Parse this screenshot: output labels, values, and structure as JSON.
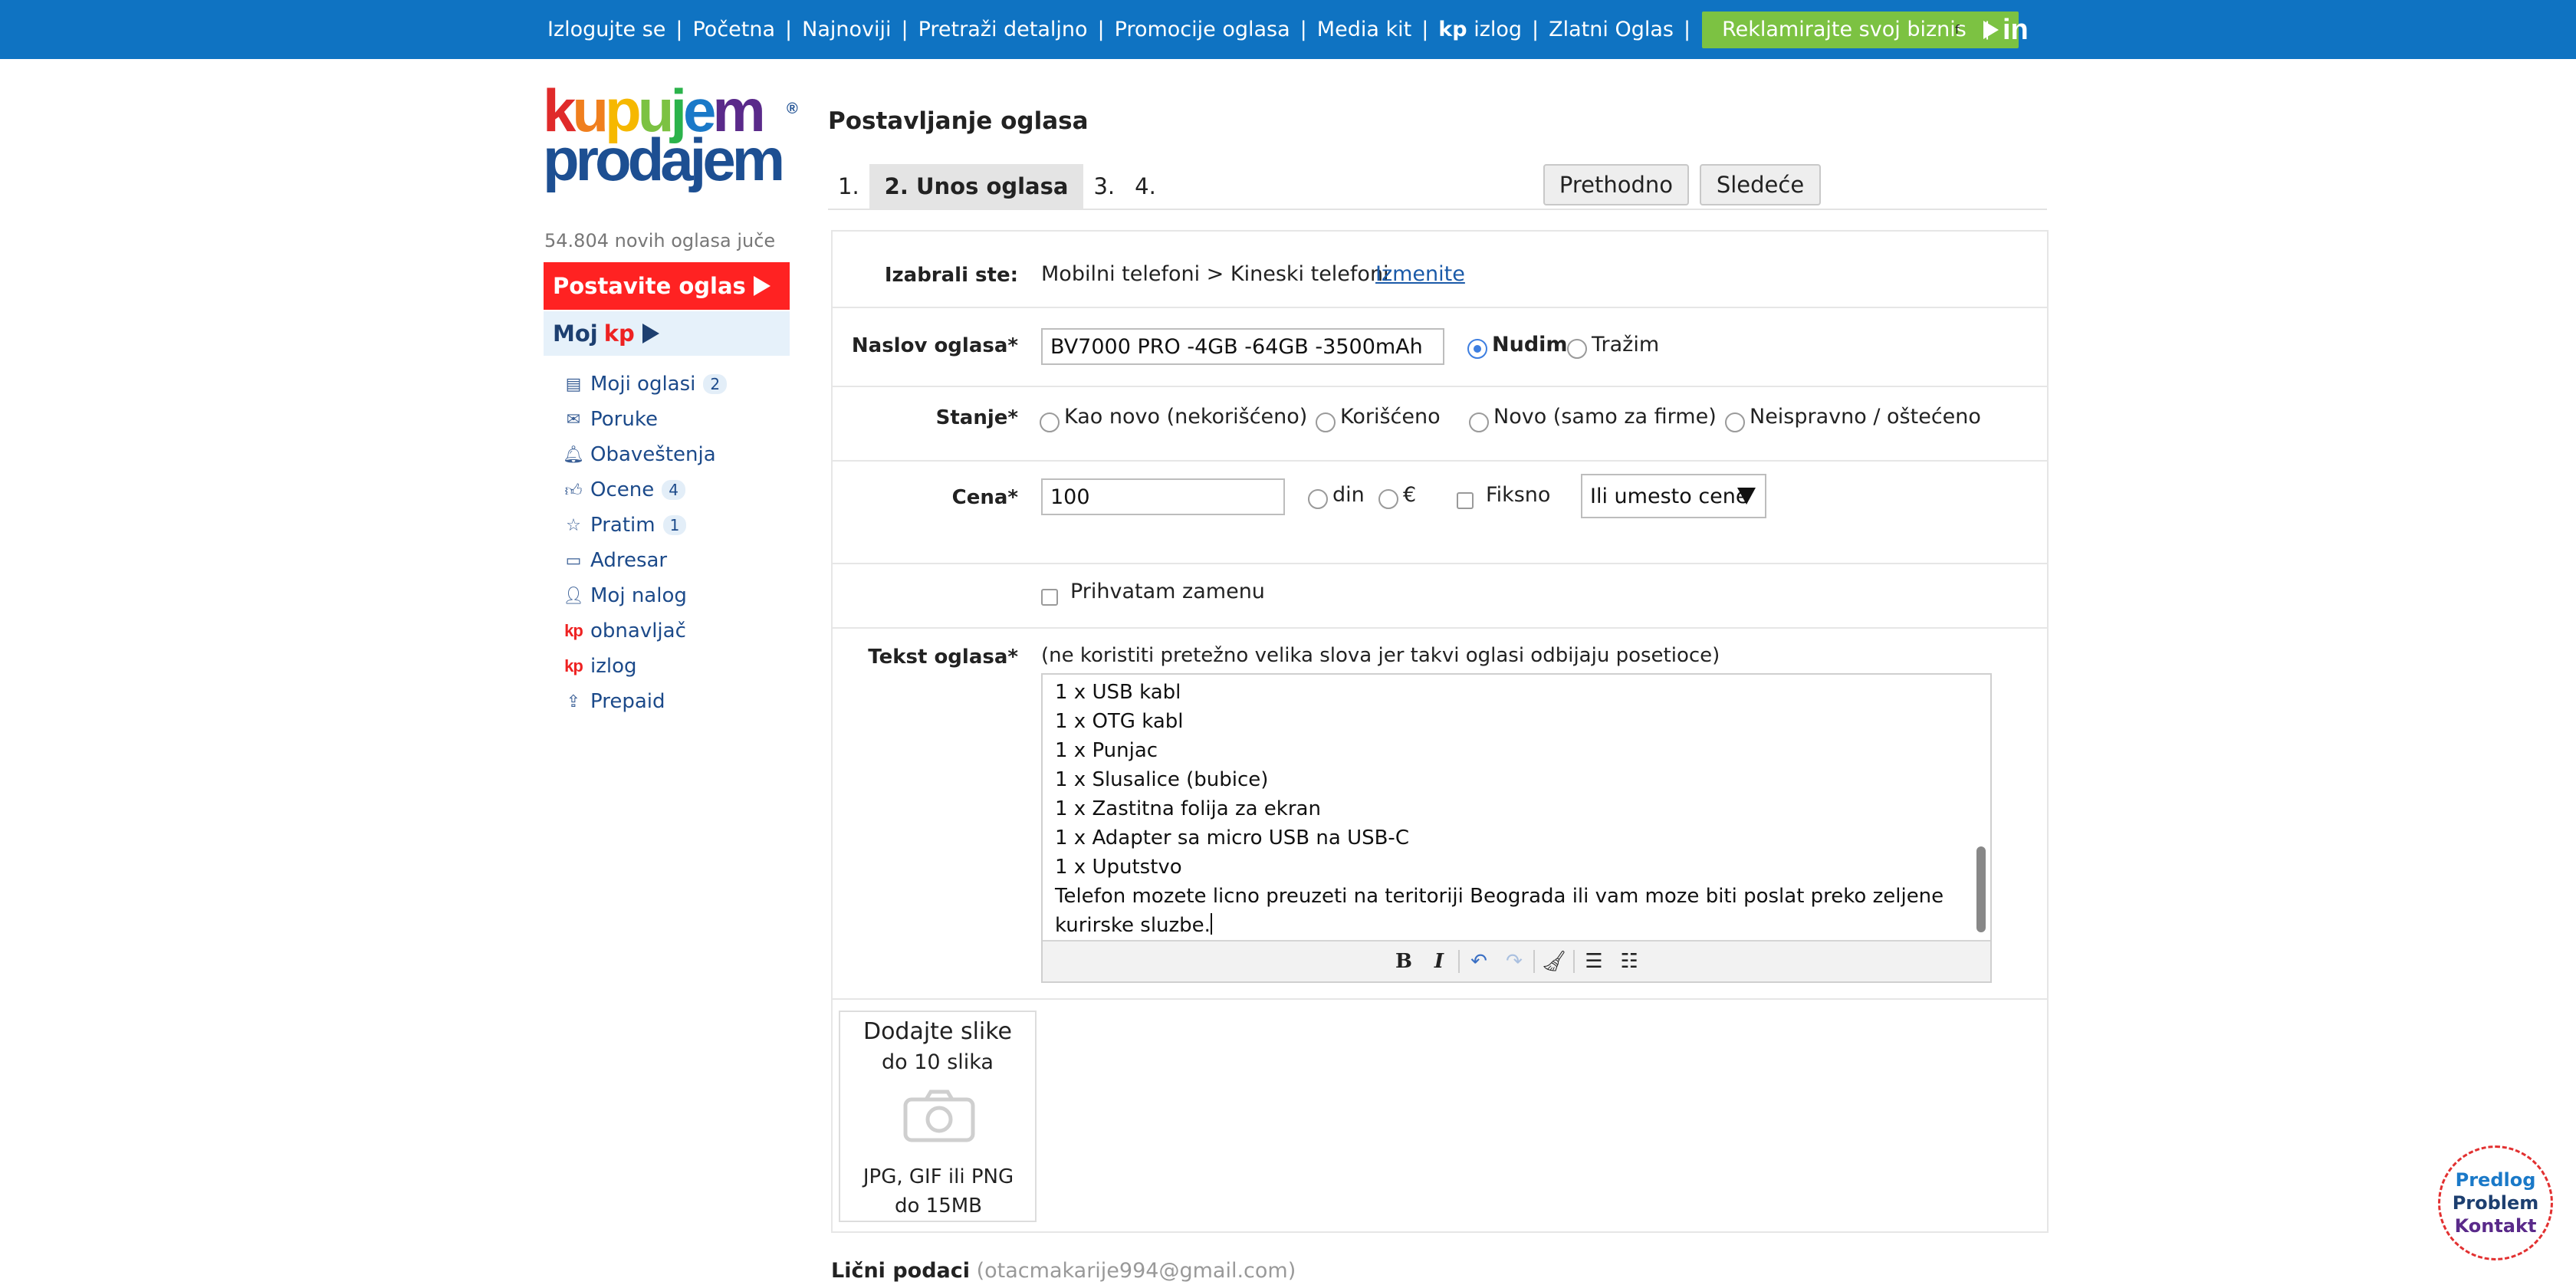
{
  "topnav": {
    "items": [
      "Izlogujte se",
      "Početna",
      "Najnoviji",
      "Pretraži detaljno",
      "Promocije oglasa",
      "Media kit"
    ],
    "izlog_prefix": "kp",
    "izlog_label": "izlog",
    "zlatni": "Zlatni Oglas",
    "promo": "Reklamirajte svoj biznis",
    "fb": "f",
    "social_sep": "|",
    "linkedin": "in"
  },
  "logo": {
    "line1": [
      "k",
      "u",
      "p",
      "u",
      "j",
      "e",
      "m"
    ],
    "line1_colors": [
      "#e02a2a",
      "#f07f1e",
      "#f6b800",
      "#7cc242",
      "#2bb34b",
      "#1a79c8",
      "#5a2a8a"
    ],
    "line2": "prodajem",
    "reg": "®"
  },
  "sidebar": {
    "new_ads": "54.804 novih oglasa juče",
    "post_button": "Postavite oglas",
    "moj_label": "Moj",
    "moj_kp": "kp",
    "menu": [
      {
        "icon": "list-icon",
        "glyph": "▤",
        "label": "Moji oglasi",
        "count": "2"
      },
      {
        "icon": "messages-icon",
        "glyph": "✉",
        "label": "Poruke",
        "count": ""
      },
      {
        "icon": "bell-icon",
        "glyph": "🔔︎",
        "label": "Obaveštenja",
        "count": ""
      },
      {
        "icon": "thumbs-up-icon",
        "glyph": "👍︎",
        "label": "Ocene",
        "count": "4"
      },
      {
        "icon": "star-icon",
        "glyph": "☆",
        "label": "Pratim",
        "count": "1"
      },
      {
        "icon": "address-book-icon",
        "glyph": "▭",
        "label": "Adresar",
        "count": ""
      },
      {
        "icon": "user-icon",
        "glyph": "👤︎",
        "label": "Moj nalog",
        "count": ""
      },
      {
        "icon": "kp-icon",
        "glyph": "kp",
        "label": "obnavljač",
        "count": ""
      },
      {
        "icon": "kp-icon",
        "glyph": "kp",
        "label": "izlog",
        "count": ""
      },
      {
        "icon": "prepaid-icon",
        "glyph": "⇪",
        "label": "Prepaid",
        "count": ""
      }
    ]
  },
  "main": {
    "title": "Postavljanje oglasa",
    "steps": [
      "1.",
      "2. Unos oglasa",
      "3.",
      "4."
    ],
    "prev": "Prethodno",
    "next": "Sledeće"
  },
  "form": {
    "izabrali_label": "Izabrali ste:",
    "category": "Mobilni telefoni > Kineski telefoni",
    "change_link": "Izmenite",
    "naslov_label": "Naslov oglasa*",
    "naslov_value": "BV7000 PRO -4GB -64GB -3500mAh",
    "nudim": "Nudim",
    "trazim": "Tražim",
    "stanje_label": "Stanje*",
    "stanje_options": [
      "Kao novo (nekorišćeno)",
      "Korišćeno",
      "Novo (samo za firme)",
      "Neispravno / oštećeno"
    ],
    "cena_label": "Cena*",
    "cena_value": "100",
    "currency_din": "din",
    "currency_eur": "€",
    "fiksno": "Fiksno",
    "price_alt_select": "Ili umesto cene",
    "zamena": "Prihvatam zamenu",
    "tekst_label": "Tekst oglasa*",
    "tekst_hint": "(ne koristiti pretežno velika slova jer takvi oglasi odbijaju posetioce)",
    "tekst_lines": [
      "1 x USB kabl",
      "1 x OTG kabl",
      "1 x Punjac",
      "1 x Slusalice (bubice)",
      "1 x Zastitna folija za ekran",
      "1 x Adapter sa micro USB na USB-C",
      "1 x Uputstvo",
      "Telefon mozete licno preuzeti na teritoriji Beograda ili vam moze biti poslat preko zeljene kurirske sluzbe."
    ],
    "toolbar": {
      "bold": "B",
      "italic": "I",
      "undo": "↶",
      "redo": "↷",
      "clean": "🧹︎",
      "bullets": "☰",
      "numbers": "☷"
    },
    "photos": {
      "title": "Dodajte slike",
      "sub": "do 10 slika",
      "foot": "JPG, GIF ili PNG do 15MB"
    }
  },
  "personal": {
    "label": "Lični podaci",
    "email": "(otacmakarije994@gmail.com)"
  },
  "feedback": {
    "line1": "Predlog",
    "line2": "Problem",
    "line3": "Kontakt"
  }
}
